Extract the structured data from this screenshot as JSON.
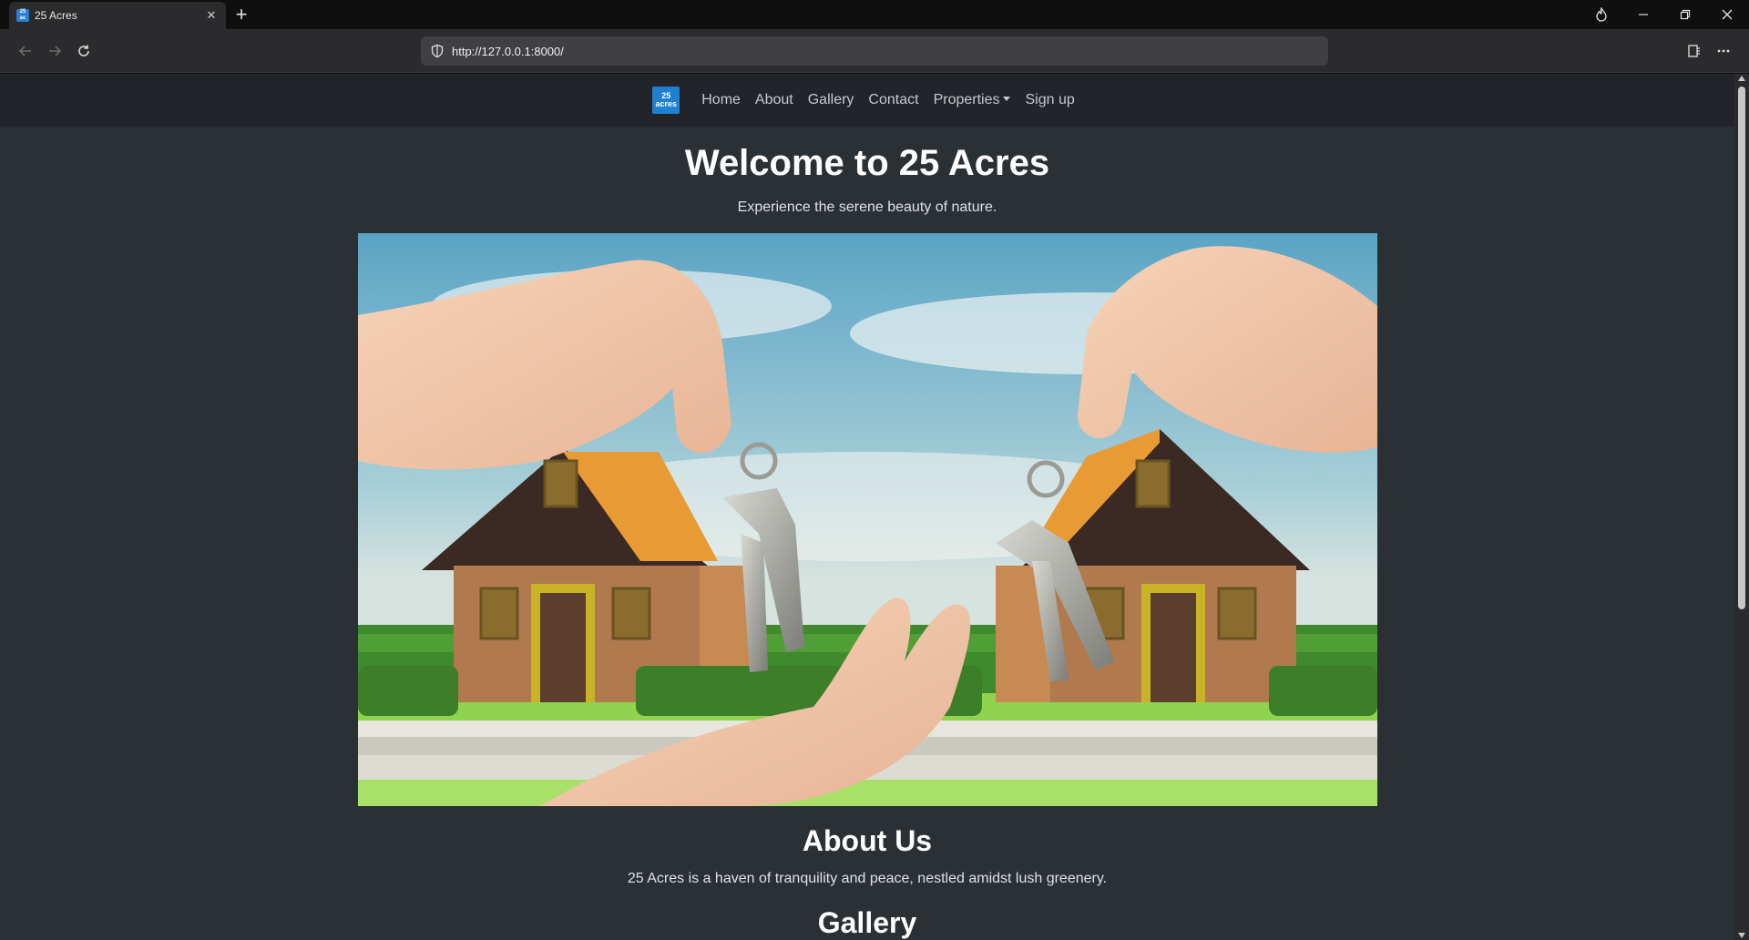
{
  "browser": {
    "tab_title": "25 Acres",
    "tab_favicon_text": "25 acres",
    "url": "http://127.0.0.1:8000/",
    "icons": {
      "back": "arrow-left-icon",
      "forward": "arrow-right-icon",
      "reload": "reload-icon",
      "shield": "shield-icon",
      "reading_list": "reading-list-icon",
      "menu": "more-icon",
      "fire": "flame-icon"
    }
  },
  "site": {
    "brand_text_line1": "25",
    "brand_text_line2": "acres",
    "nav": {
      "home": "Home",
      "about": "About",
      "gallery": "Gallery",
      "contact": "Contact",
      "properties": "Properties",
      "signup": "Sign up"
    },
    "hero": {
      "title": "Welcome to 25 Acres",
      "subtitle": "Experience the serene beauty of nature."
    },
    "about": {
      "title": "About Us",
      "text": "25 Acres is a haven of tranquility and peace, nestled amidst lush greenery."
    },
    "gallery": {
      "title": "Gallery"
    },
    "colors": {
      "page_bg": "#2b3035",
      "navbar_bg": "#212529",
      "brand": "#1f7fd0"
    }
  }
}
